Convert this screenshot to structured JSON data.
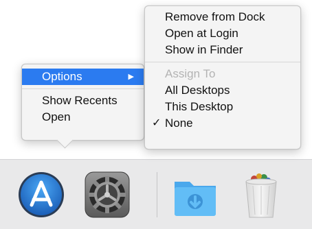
{
  "dock": {
    "apps": [
      {
        "name": "App Store",
        "icon": "app-store-icon"
      },
      {
        "name": "System Preferences",
        "icon": "gear-icon"
      },
      {
        "name": "Downloads",
        "icon": "downloads-folder-icon"
      },
      {
        "name": "Trash",
        "icon": "trash-icon"
      }
    ]
  },
  "context_menu": {
    "options_label": "Options",
    "show_recents_label": "Show Recents",
    "open_label": "Open"
  },
  "options_submenu": {
    "remove_label": "Remove from Dock",
    "open_at_login_label": "Open at Login",
    "show_in_finder_label": "Show in Finder",
    "assign_to_label": "Assign To",
    "all_desktops_label": "All Desktops",
    "this_desktop_label": "This Desktop",
    "none_label": "None",
    "checked_item": "None"
  },
  "colors": {
    "highlight": "#2b7bf0",
    "disabled_text": "#b3b3b3",
    "folder_blue": "#5bb7f5"
  }
}
